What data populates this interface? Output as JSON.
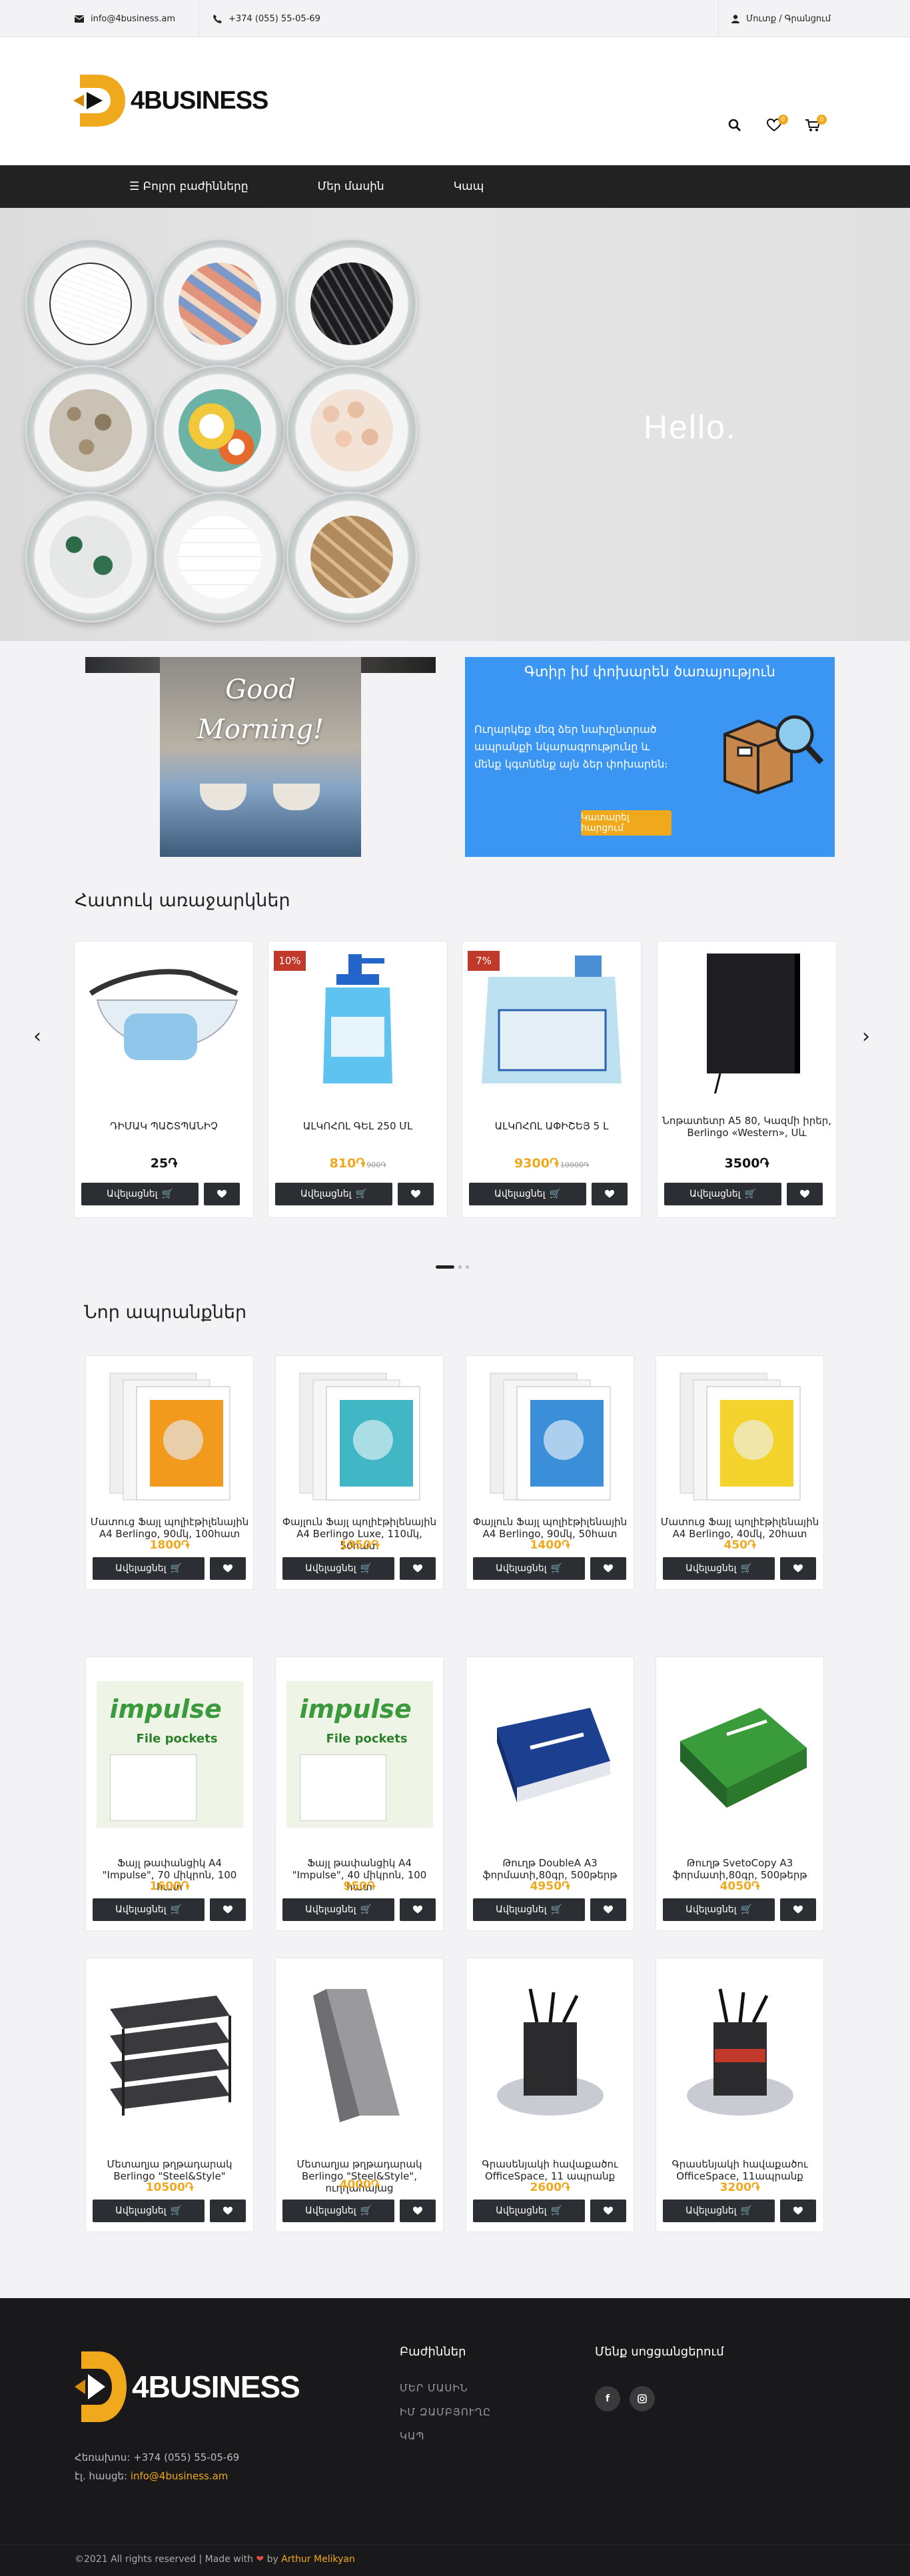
{
  "topbar": {
    "email": "info@4business.am",
    "phone": "+374 (055) 55-05-69",
    "auth": "Մուտք / Գրանցում"
  },
  "brand": {
    "logo_text": "4BUSINESS",
    "accent": "#f0a81c",
    "dark": "#222222"
  },
  "header": {
    "wishlist_count": "0",
    "cart_count": "0"
  },
  "nav": {
    "all_sections": "Բոլոր բաժինները",
    "about": "Մեր մասին",
    "contact": "Կապ"
  },
  "hero": {
    "text": "Hello."
  },
  "promo": {
    "morning_line1": "Good",
    "morning_line2": "Morning!",
    "service_title": "Գտիր իմ փոխարեն ծառայություն",
    "service_desc": "Ուղարկեք մեզ ձեր նախընտրած ապրանքի նկարագրությունը և մենք կգտնենք այն ձեր փոխարեն։",
    "service_button": "Կատարել հարցում"
  },
  "special": {
    "title": "Հատուկ առաջարկներ",
    "items": [
      {
        "name": "ԴԻՄԱԿ ՊԱՇՏՊԱՆԻՉ",
        "price": "25֏",
        "old": "",
        "discount": ""
      },
      {
        "name": "ԱԼԿՈՀՈԼ ԳԵԼ 250 ՄԼ",
        "price": "810֏",
        "old": "900֏",
        "discount": "10%"
      },
      {
        "name": "ԱԼԿՈՀՈԼ ԱՓԻՇԵՅ 5 L",
        "price": "9300֏",
        "old": "10000֏",
        "discount": "7%"
      },
      {
        "name": "Նոթատետր A5 80, Կազմի իրեր, Berlingo «Western», Սև",
        "price": "3500֏",
        "old": "",
        "discount": ""
      }
    ]
  },
  "new_products": {
    "title": "Նոր ապրանքներ",
    "items": [
      {
        "name": "Մատուց Ֆայլ պոլիէթիլենային A4 Berlingo, 90մկ, 100հատ",
        "price": "1800֏"
      },
      {
        "name": "Փայլուն Ֆայլ պոլիէթիլենային A4 Berlingo Luxe, 110մկ, 50հատ",
        "price": "1950֏"
      },
      {
        "name": "Փայլուն Ֆայլ պոլիէթիլենային A4 Berlingo, 90մկ, 50հատ",
        "price": "1400֏"
      },
      {
        "name": "Մատուց Ֆայլ պոլիէթիլենային A4 Berlingo, 40մկ, 20հատ",
        "price": "450֏"
      },
      {
        "name": "Ֆայլ թափանցիկ A4 \"Impulse\", 70 միկրոն, 100 հատ",
        "price": "1600֏"
      },
      {
        "name": "Ֆայլ թափանցիկ A4 \"Impulse\", 40 միկրոն, 100 հատ",
        "price": "950֏"
      },
      {
        "name": "Թուղթ DoubleA A3 ֆորմատի,80գր, 500թերթ",
        "price": "4950֏"
      },
      {
        "name": "Թուղթ SvetoCopy A3 ֆորմատի,80գր, 500թերթ",
        "price": "4050֏"
      },
      {
        "name": "Մետաղյա թղթադարակ Berlingo \"Steel&Style\"",
        "price": "10500֏"
      },
      {
        "name": "Մետաղյա թղթադարակ Berlingo \"Steel&Style\", ուղղահայաց",
        "price": "4000֏"
      },
      {
        "name": "Գրասենյակի հավաքածու OfficeSpace, 11 ապրանք",
        "price": "2600֏"
      },
      {
        "name": "Գրասենյակի հավաքածու OfficeSpace, 11ապրանք",
        "price": "3200֏"
      }
    ]
  },
  "labels": {
    "add_to_cart": "Ավելացնել",
    "impulse": "impulse",
    "file_pockets": "File pockets"
  },
  "footer": {
    "logo_text": "4BUSINESS",
    "phone_label": "Հեռախոս:",
    "phone": "+374 (055) 55-05-69",
    "email_label": "էլ. հասցե:",
    "email": "info@4business.am",
    "sections_title": "Բաժիններ",
    "links": [
      "ՄԵՐ ՄԱՍԻՆ",
      "ԻՄ ԶԱՄԲՅՈՒՂԸ",
      "ԿԱՊ"
    ],
    "social_title": "Մենք սոցցանցերում",
    "copyright": "©2021 All rights reserved | Made with",
    "by": "by",
    "author": "Arthur Melikyan"
  }
}
